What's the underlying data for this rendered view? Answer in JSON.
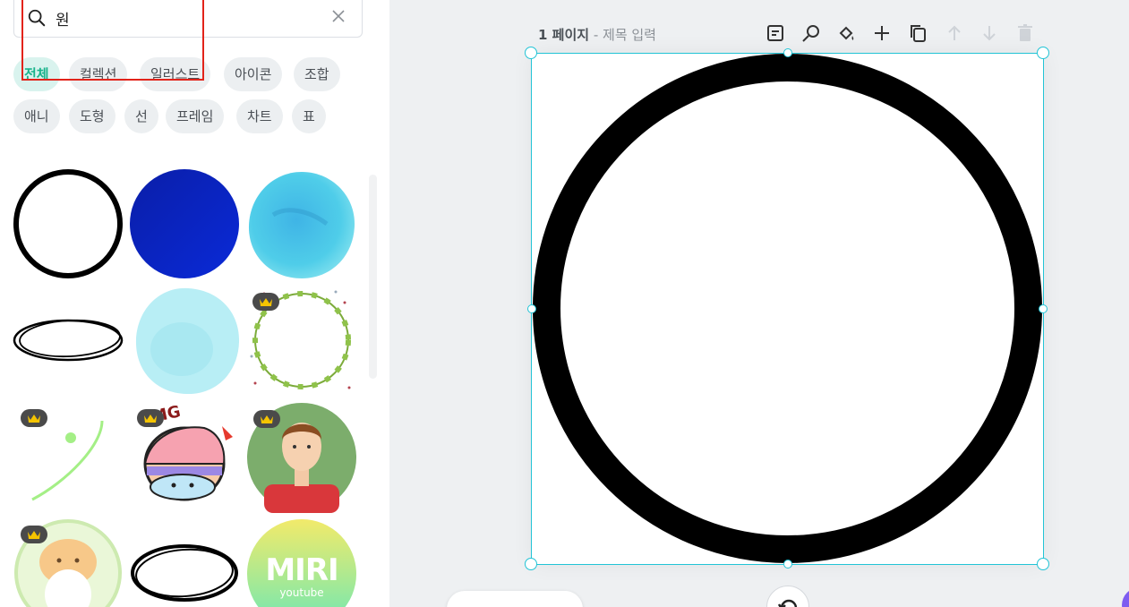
{
  "search": {
    "value": "원",
    "clear_icon": "close-icon",
    "search_icon": "search-icon"
  },
  "filters": [
    {
      "label": "전체",
      "active": true
    },
    {
      "label": "컬렉션",
      "active": false
    },
    {
      "label": "일러스트",
      "active": false
    },
    {
      "label": "아이콘",
      "active": false
    },
    {
      "label": "조합",
      "active": false
    },
    {
      "label": "애니",
      "active": false
    },
    {
      "label": "도형",
      "active": false
    },
    {
      "label": "선",
      "active": false
    },
    {
      "label": "프레임",
      "active": false
    },
    {
      "label": "차트",
      "active": false
    },
    {
      "label": "표",
      "active": false
    }
  ],
  "results": [
    {
      "name": "black-ring",
      "premium": false
    },
    {
      "name": "blue-gradient-circle",
      "premium": false
    },
    {
      "name": "watercolor-blue-circle",
      "premium": false
    },
    {
      "name": "sketch-oval",
      "premium": false
    },
    {
      "name": "watercolor-aqua-circle",
      "premium": false
    },
    {
      "name": "leaf-wreath",
      "premium": true
    },
    {
      "name": "green-arc-line",
      "premium": true
    },
    {
      "name": "omg-character",
      "premium": true,
      "sticker_text": "OMG"
    },
    {
      "name": "man-avatar-circle",
      "premium": true
    },
    {
      "name": "cat-circle",
      "premium": true
    },
    {
      "name": "brush-oval",
      "premium": false
    },
    {
      "name": "miri-youtube-badge",
      "premium": false,
      "title": "MIRI",
      "subtitle": "youtube"
    }
  ],
  "canvas": {
    "page_number": "1 페이지",
    "separator": " - ",
    "title_placeholder": "제목 입력",
    "toolbar": [
      "note-icon",
      "magic-icon",
      "fill-icon",
      "add-icon",
      "copy-icon",
      "arrow-up-icon",
      "arrow-down-icon",
      "trash-icon"
    ],
    "accent_color": "#22c4d6"
  },
  "colors": {
    "highlight": "#e2231a",
    "active_chip": "#19b38c",
    "crown": "#f5c400"
  }
}
